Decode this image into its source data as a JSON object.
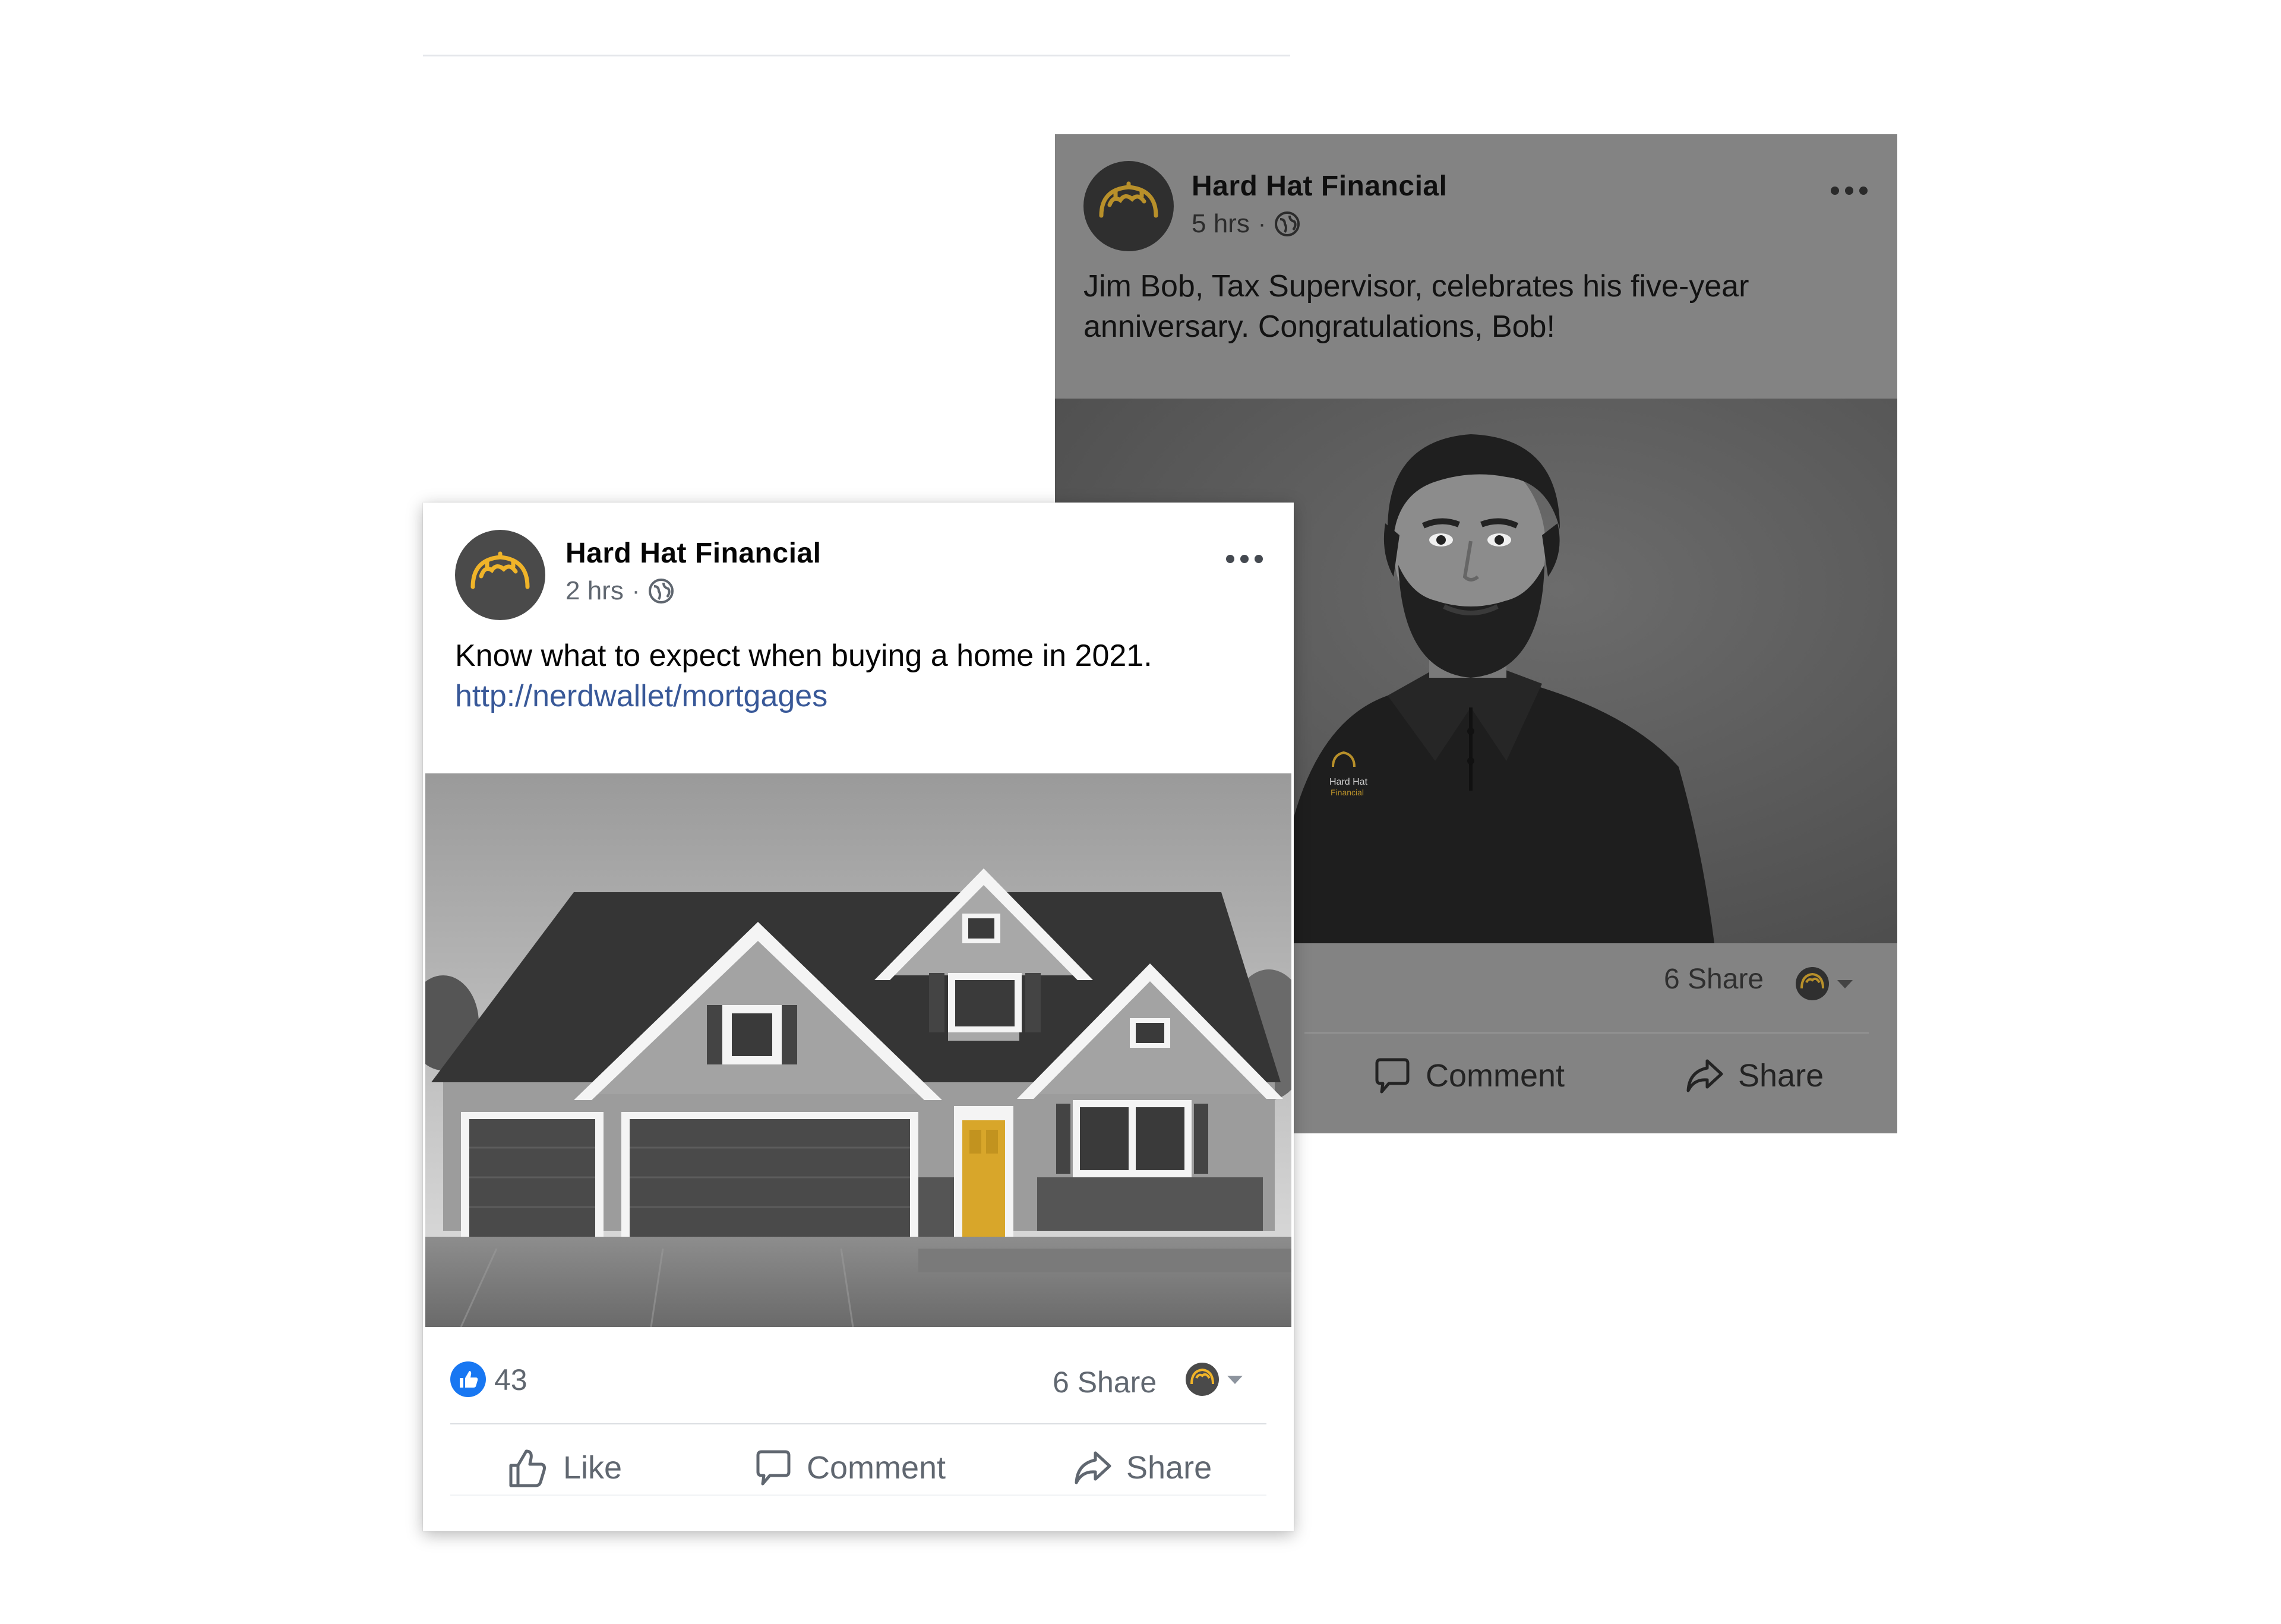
{
  "posts": [
    {
      "page_name": "Hard Hat Financial",
      "time": "5 hrs",
      "text": "Jim Bob, Tax Supervisor, celebrates his five-year anniversary. Congratulations, Bob!",
      "image": "portrait-photo",
      "share_count": "6 Share",
      "actions": {
        "comment": "Comment",
        "share": "Share"
      }
    },
    {
      "page_name": "Hard Hat Financial",
      "time": "2 hrs",
      "text": "Know what to expect when buying a home in 2021.",
      "link": "http://nerdwallet/mortgages",
      "image": "house-photo",
      "likes": "43",
      "share_count": "6 Share",
      "actions": {
        "like": "Like",
        "comment": "Comment",
        "share": "Share"
      }
    }
  ],
  "shirt_logo_text": [
    "Hard Hat",
    "Financial"
  ],
  "icons": [
    "hard-hat-logo-icon",
    "globe-icon",
    "more-options-icon",
    "like-thumb-icon",
    "comment-icon",
    "share-icon",
    "chevron-down-icon"
  ],
  "colors": {
    "brand_yellow": "#f0b429",
    "link_blue": "#385898",
    "like_blue": "#1877f2",
    "door_yellow": "#d8a62a"
  }
}
